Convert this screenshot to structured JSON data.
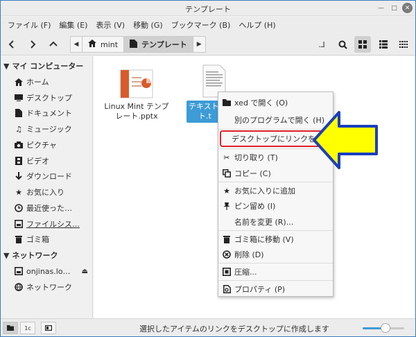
{
  "window": {
    "title": "テンプレート"
  },
  "menu": [
    "ファイル (F)",
    "編集 (E)",
    "表示 (V)",
    "移動 (G)",
    "ブックマーク (B)",
    "ヘルプ (H)"
  ],
  "breadcrumb": {
    "items": [
      "mint",
      "テンプレート"
    ]
  },
  "sidebar": {
    "my_computer": "マイ コンピューター",
    "items": [
      "ホーム",
      "デスクトップ",
      "ドキュメント",
      "ミュージック",
      "ピクチャ",
      "ビデオ",
      "ダウンロード",
      "お気に入り",
      "最近使った…",
      "ファイルシス…",
      "ゴミ箱"
    ],
    "network": "ネットワーク",
    "network_items": [
      "onjinas.lo…",
      "ネットワーク"
    ]
  },
  "files": [
    {
      "name_line1": "Linux Mint テンプ",
      "name_line2": "レート.pptx"
    },
    {
      "name_line1": "テキスト",
      "name_line2": "ト.t"
    }
  ],
  "context_menu": {
    "items": [
      "xed で開く (O)",
      "別のプログラムで開く (H)",
      "デスクトップにリンクを作成",
      "切り取り (T)",
      "コピー (C)",
      "お気に入りに追加",
      "ピン留め (I)",
      "名前を変更 (R)...",
      "ゴミ箱に移動 (V)",
      "削除 (D)",
      "圧縮...",
      "プロパティ (P)"
    ],
    "highlight_color": "#e0202a"
  },
  "annotation": {
    "arrow_color": "#ffff00",
    "arrow_outline": "#1a3fbf"
  },
  "status": {
    "text": "選択したアイテムのリンクをデスクトップに作成します",
    "zoom_level": 0.55
  },
  "colors": {
    "accent": "#3d9bd6",
    "window_border": "#3b7bbf"
  }
}
